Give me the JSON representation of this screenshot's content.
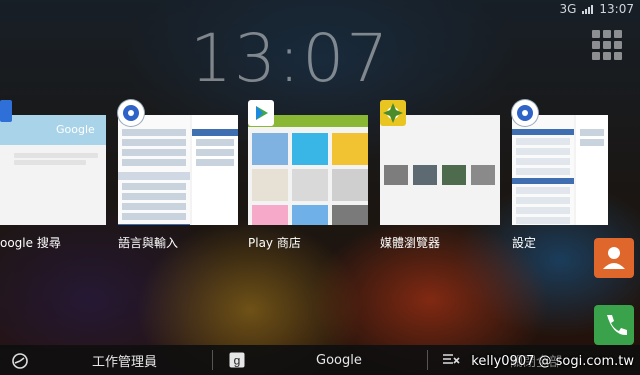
{
  "status_bar": {
    "network": "3G",
    "time": "13:07"
  },
  "lockscreen": {
    "clock": "13:07"
  },
  "recent_apps": [
    {
      "label": "oogle 搜尋",
      "thumb_text": "Google"
    },
    {
      "label": "語言與輸入"
    },
    {
      "label": "Play 商店"
    },
    {
      "label": "媒體瀏覽器"
    },
    {
      "label": "設定"
    }
  ],
  "bottom_bar": {
    "task_manager": "工作管理員",
    "google": "Google",
    "clear_all": "關閉全部"
  },
  "watermark": {
    "user": "kelly0907",
    "site": "@ sogi.com.tw"
  },
  "colors": {
    "accent": "#2f5d94",
    "play_green": "#8ab734"
  }
}
